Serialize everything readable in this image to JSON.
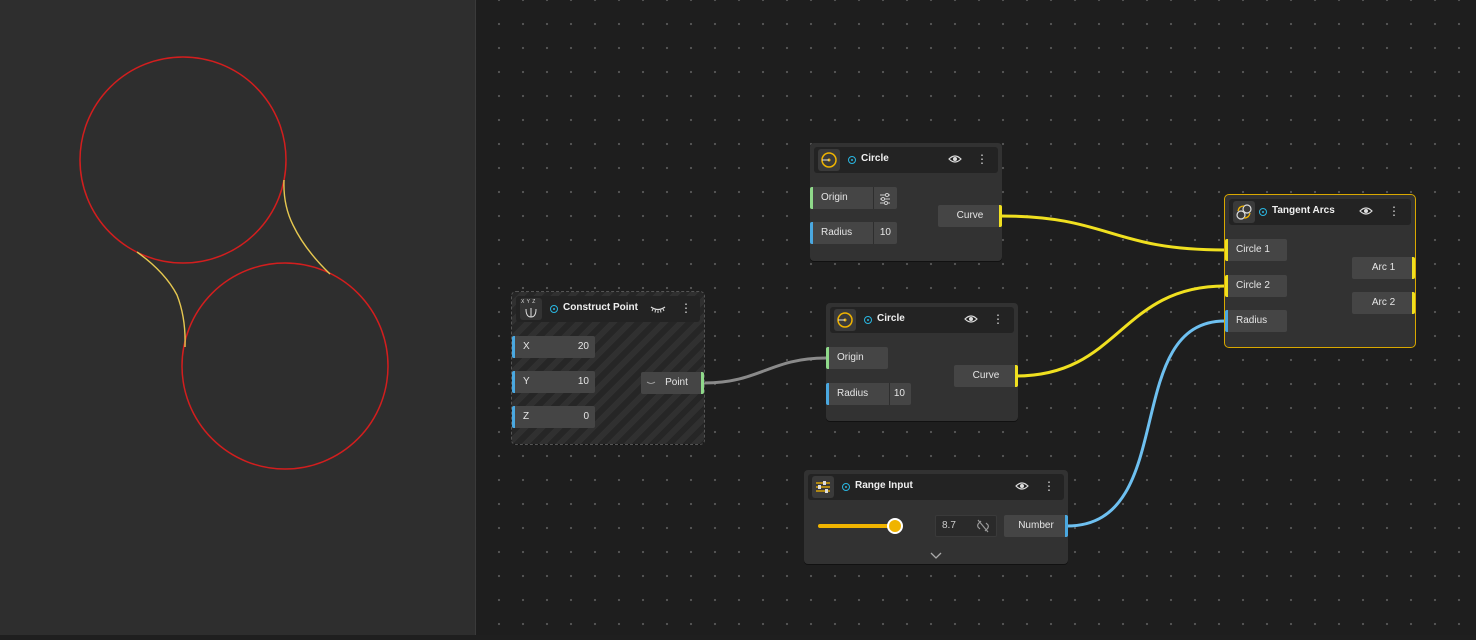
{
  "nodes": {
    "circle_a": {
      "title": "Circle",
      "inputs": {
        "origin": "Origin",
        "radius": "Radius",
        "radius_value": "10"
      },
      "output": "Curve"
    },
    "circle_b": {
      "title": "Circle",
      "inputs": {
        "origin": "Origin",
        "radius": "Radius",
        "radius_value": "10"
      },
      "output": "Curve"
    },
    "construct_point": {
      "title": "Construct Point",
      "icon_label": "X Y Z",
      "inputs": [
        {
          "label": "X",
          "value": "20"
        },
        {
          "label": "Y",
          "value": "10"
        },
        {
          "label": "Z",
          "value": "0"
        }
      ],
      "output": "Point"
    },
    "range_input": {
      "title": "Range Input",
      "value": "8.7",
      "slider_fraction": 0.87,
      "output": "Number"
    },
    "tangent_arcs": {
      "title": "Tangent Arcs",
      "inputs": [
        "Circle 1",
        "Circle 2",
        "Radius"
      ],
      "outputs": [
        "Arc 1",
        "Arc 2"
      ]
    }
  },
  "icons": {
    "visibility": "eye-icon",
    "hidden": "eye-closed-icon",
    "menu": "more-vertical-icon",
    "settings": "sliders-icon",
    "unlink": "link-off-icon",
    "expand": "chevron-down-icon"
  },
  "colors": {
    "accent": "#f0b400",
    "curve_wire": "#f0e020",
    "number_wire": "#6ec0f0",
    "point_wire": "#8a8a8a",
    "viewport_circle": "#d21e1e",
    "viewport_arc": "#e6c850",
    "selected_outline": "#d9a800"
  }
}
